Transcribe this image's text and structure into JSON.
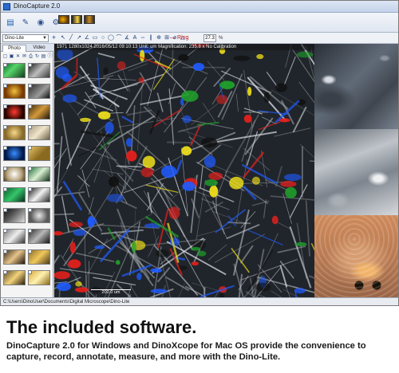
{
  "window": {
    "title": "DinoCapture 2.0"
  },
  "toolbar": {
    "zoom_value": "27.3",
    "zoom_suffix": "%",
    "tool_label": "Ring",
    "combo_value": "Dino-Lite"
  },
  "left_panel": {
    "tabs": [
      "Photo",
      "Video"
    ],
    "selected_tab": "Photo"
  },
  "viewport": {
    "info_bar": "1971    1280x1024    2016/05/12 09:10:13   Unit: um   Magnification: 235.8 x   No Calibration",
    "scale_bar": "200.0 um"
  },
  "status_bar": {
    "path": "C:\\Users\\DinoUser\\Documents\\Digital Microscope\\Dino-Lite"
  },
  "caption": {
    "headline": "The included software.",
    "description": "DinoCapture 2.0 for Windows and DinoXcope for Mac OS provide the convenience to capture, record, annotate, measure, and more with the Dino-Lite."
  },
  "icons": {
    "app": "app-icon",
    "folder": "folder-icon",
    "pen": "pen-icon",
    "capture": "capture-icon",
    "ring": "ring-icon"
  }
}
